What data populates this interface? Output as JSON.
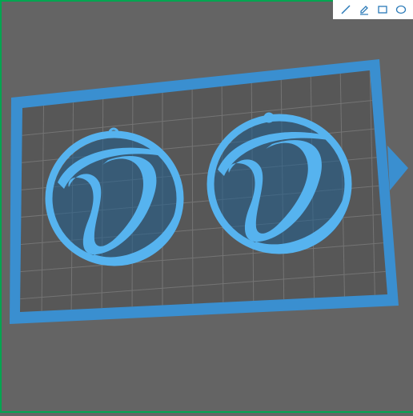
{
  "app": {
    "name": "3d-print-bed-preview"
  },
  "toolbar": {
    "tools": [
      {
        "name": "line-tool",
        "icon": "line-icon"
      },
      {
        "name": "pen-tool",
        "icon": "pen-icon"
      },
      {
        "name": "rectangle-tool",
        "icon": "rectangle-icon"
      },
      {
        "name": "ellipse-tool",
        "icon": "ellipse-icon"
      }
    ],
    "icon_color": "#2a7ab8"
  },
  "scene": {
    "background": "#646464",
    "bed_border_color": "#3a8fd0",
    "bed_fill_color": "#555555",
    "grid_color": "#6e6e6e",
    "model_color": "#56b3ef",
    "model_shadow_color": "#1f5f8f",
    "models": [
      {
        "name": "earring-left",
        "letter": "O",
        "shape": "round-pendant-with-loop"
      },
      {
        "name": "earring-right",
        "letter": "O",
        "shape": "round-pendant-with-loop"
      }
    ]
  }
}
